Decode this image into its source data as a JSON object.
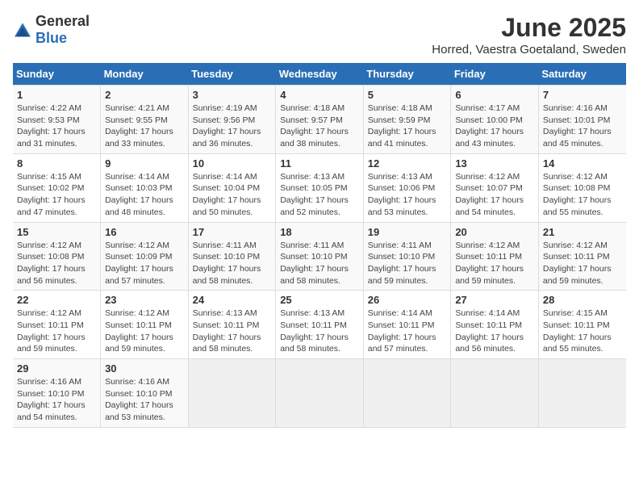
{
  "logo": {
    "general": "General",
    "blue": "Blue"
  },
  "header": {
    "title": "June 2025",
    "subtitle": "Horred, Vaestra Goetaland, Sweden"
  },
  "weekdays": [
    "Sunday",
    "Monday",
    "Tuesday",
    "Wednesday",
    "Thursday",
    "Friday",
    "Saturday"
  ],
  "weeks": [
    [
      {
        "day": "1",
        "detail": "Sunrise: 4:22 AM\nSunset: 9:53 PM\nDaylight: 17 hours and 31 minutes."
      },
      {
        "day": "2",
        "detail": "Sunrise: 4:21 AM\nSunset: 9:55 PM\nDaylight: 17 hours and 33 minutes."
      },
      {
        "day": "3",
        "detail": "Sunrise: 4:19 AM\nSunset: 9:56 PM\nDaylight: 17 hours and 36 minutes."
      },
      {
        "day": "4",
        "detail": "Sunrise: 4:18 AM\nSunset: 9:57 PM\nDaylight: 17 hours and 38 minutes."
      },
      {
        "day": "5",
        "detail": "Sunrise: 4:18 AM\nSunset: 9:59 PM\nDaylight: 17 hours and 41 minutes."
      },
      {
        "day": "6",
        "detail": "Sunrise: 4:17 AM\nSunset: 10:00 PM\nDaylight: 17 hours and 43 minutes."
      },
      {
        "day": "7",
        "detail": "Sunrise: 4:16 AM\nSunset: 10:01 PM\nDaylight: 17 hours and 45 minutes."
      }
    ],
    [
      {
        "day": "8",
        "detail": "Sunrise: 4:15 AM\nSunset: 10:02 PM\nDaylight: 17 hours and 47 minutes."
      },
      {
        "day": "9",
        "detail": "Sunrise: 4:14 AM\nSunset: 10:03 PM\nDaylight: 17 hours and 48 minutes."
      },
      {
        "day": "10",
        "detail": "Sunrise: 4:14 AM\nSunset: 10:04 PM\nDaylight: 17 hours and 50 minutes."
      },
      {
        "day": "11",
        "detail": "Sunrise: 4:13 AM\nSunset: 10:05 PM\nDaylight: 17 hours and 52 minutes."
      },
      {
        "day": "12",
        "detail": "Sunrise: 4:13 AM\nSunset: 10:06 PM\nDaylight: 17 hours and 53 minutes."
      },
      {
        "day": "13",
        "detail": "Sunrise: 4:12 AM\nSunset: 10:07 PM\nDaylight: 17 hours and 54 minutes."
      },
      {
        "day": "14",
        "detail": "Sunrise: 4:12 AM\nSunset: 10:08 PM\nDaylight: 17 hours and 55 minutes."
      }
    ],
    [
      {
        "day": "15",
        "detail": "Sunrise: 4:12 AM\nSunset: 10:08 PM\nDaylight: 17 hours and 56 minutes."
      },
      {
        "day": "16",
        "detail": "Sunrise: 4:12 AM\nSunset: 10:09 PM\nDaylight: 17 hours and 57 minutes."
      },
      {
        "day": "17",
        "detail": "Sunrise: 4:11 AM\nSunset: 10:10 PM\nDaylight: 17 hours and 58 minutes."
      },
      {
        "day": "18",
        "detail": "Sunrise: 4:11 AM\nSunset: 10:10 PM\nDaylight: 17 hours and 58 minutes."
      },
      {
        "day": "19",
        "detail": "Sunrise: 4:11 AM\nSunset: 10:10 PM\nDaylight: 17 hours and 59 minutes."
      },
      {
        "day": "20",
        "detail": "Sunrise: 4:12 AM\nSunset: 10:11 PM\nDaylight: 17 hours and 59 minutes."
      },
      {
        "day": "21",
        "detail": "Sunrise: 4:12 AM\nSunset: 10:11 PM\nDaylight: 17 hours and 59 minutes."
      }
    ],
    [
      {
        "day": "22",
        "detail": "Sunrise: 4:12 AM\nSunset: 10:11 PM\nDaylight: 17 hours and 59 minutes."
      },
      {
        "day": "23",
        "detail": "Sunrise: 4:12 AM\nSunset: 10:11 PM\nDaylight: 17 hours and 59 minutes."
      },
      {
        "day": "24",
        "detail": "Sunrise: 4:13 AM\nSunset: 10:11 PM\nDaylight: 17 hours and 58 minutes."
      },
      {
        "day": "25",
        "detail": "Sunrise: 4:13 AM\nSunset: 10:11 PM\nDaylight: 17 hours and 58 minutes."
      },
      {
        "day": "26",
        "detail": "Sunrise: 4:14 AM\nSunset: 10:11 PM\nDaylight: 17 hours and 57 minutes."
      },
      {
        "day": "27",
        "detail": "Sunrise: 4:14 AM\nSunset: 10:11 PM\nDaylight: 17 hours and 56 minutes."
      },
      {
        "day": "28",
        "detail": "Sunrise: 4:15 AM\nSunset: 10:11 PM\nDaylight: 17 hours and 55 minutes."
      }
    ],
    [
      {
        "day": "29",
        "detail": "Sunrise: 4:16 AM\nSunset: 10:10 PM\nDaylight: 17 hours and 54 minutes."
      },
      {
        "day": "30",
        "detail": "Sunrise: 4:16 AM\nSunset: 10:10 PM\nDaylight: 17 hours and 53 minutes."
      },
      null,
      null,
      null,
      null,
      null
    ]
  ]
}
